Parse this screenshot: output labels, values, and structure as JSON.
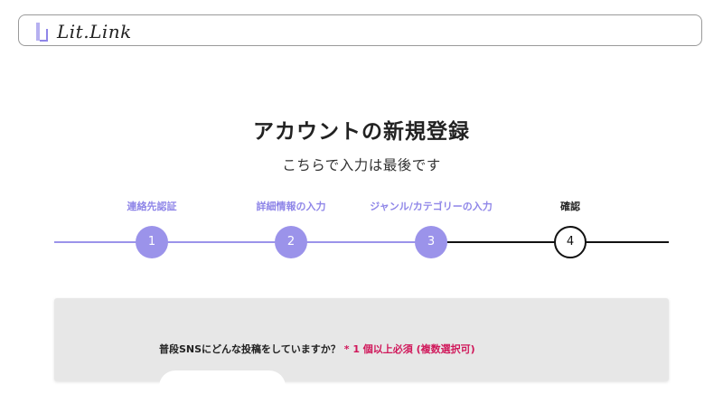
{
  "header": {
    "logo_text": "Lit.Link"
  },
  "page": {
    "title": "アカウントの新規登録",
    "subtitle": "こちらで入力は最後です"
  },
  "stepper": {
    "current_step": 4,
    "steps": [
      {
        "number": "1",
        "label": "連絡先認証",
        "status": "done"
      },
      {
        "number": "2",
        "label": "詳細情報の入力",
        "status": "done"
      },
      {
        "number": "3",
        "label": "ジャンル/カテゴリーの入力",
        "status": "done"
      },
      {
        "number": "4",
        "label": "確認",
        "status": "current"
      }
    ],
    "colors": {
      "done": "#9b93ea",
      "todo": "#111111"
    }
  },
  "form": {
    "question": "普段SNSにどんな投稿をしていますか？",
    "required_note": "* 1 個以上必須 (複数選択可)",
    "required_color": "#d0175a"
  }
}
